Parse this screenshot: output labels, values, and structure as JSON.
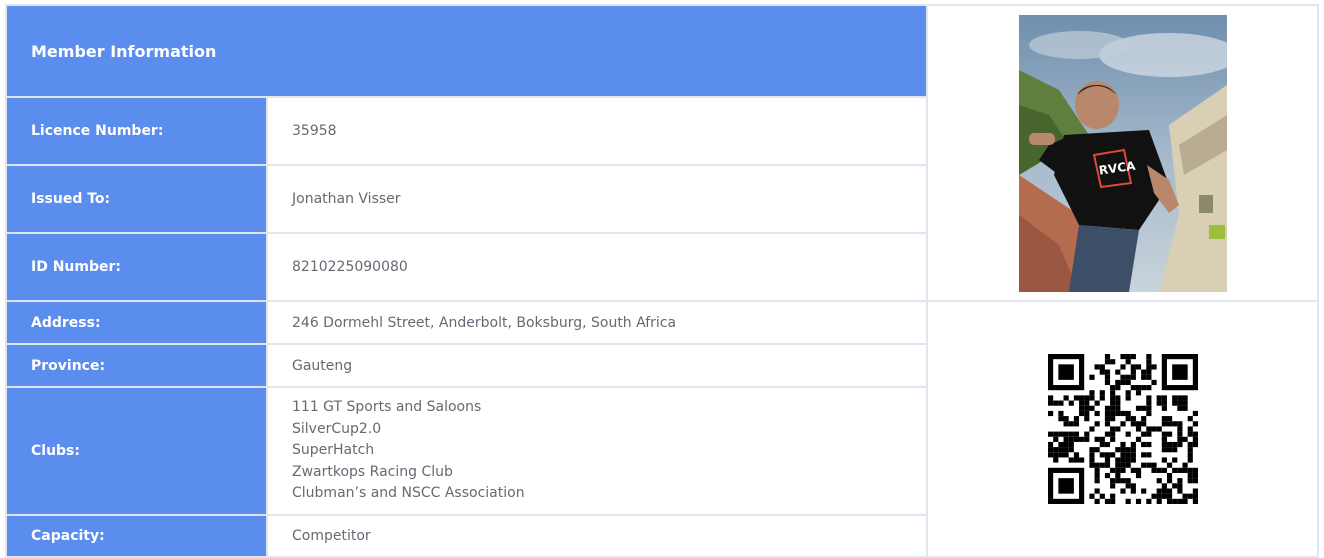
{
  "header": {
    "title": "Member Information"
  },
  "member": {
    "licence_label": "Licence Number:",
    "licence_value": "35958",
    "issued_label": "Issued To:",
    "issued_value": "Jonathan Visser",
    "id_label": "ID Number:",
    "id_value": "8210225090080",
    "address_label": "Address:",
    "address_value": "246 Dormehl Street, Anderbolt, Boksburg, South Africa",
    "province_label": "Province:",
    "province_value": "Gauteng",
    "clubs_label": "Clubs:",
    "clubs": [
      "111 GT Sports and Saloons",
      "SilverCup2.0",
      "SuperHatch",
      "Zwartkops Racing Club",
      "Clubman’s and NSCC Association"
    ],
    "capacity_label": "Capacity:",
    "capacity_value": "Competitor"
  },
  "shirt_logo": "RVCA"
}
